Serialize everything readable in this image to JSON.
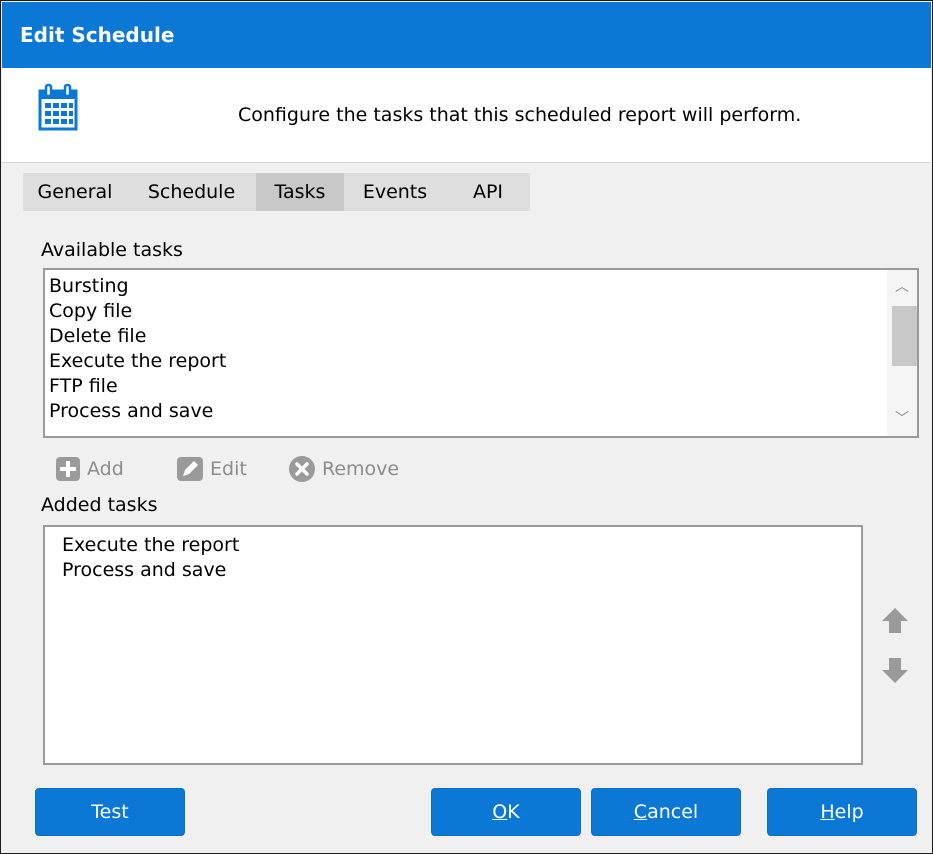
{
  "window": {
    "title": "Edit Schedule"
  },
  "header": {
    "icon": "calendar-icon",
    "message": "Configure the tasks that this scheduled report will perform."
  },
  "tabs": [
    {
      "label": "General",
      "active": false
    },
    {
      "label": "Schedule",
      "active": false
    },
    {
      "label": "Tasks",
      "active": true
    },
    {
      "label": "Events",
      "active": false
    },
    {
      "label": "API",
      "active": false
    }
  ],
  "available": {
    "label": "Available tasks",
    "items": [
      "Bursting",
      "Copy file",
      "Delete file",
      "Execute the report",
      "FTP file",
      "Process and save"
    ]
  },
  "toolbar": {
    "add": {
      "label": "Add",
      "icon": "plus-icon"
    },
    "edit": {
      "label": "Edit",
      "icon": "pencil-icon"
    },
    "remove": {
      "label": "Remove",
      "icon": "close-circle-icon"
    }
  },
  "added": {
    "label": "Added tasks",
    "items": [
      "Execute the report",
      "Process and save"
    ]
  },
  "move": {
    "up_icon": "arrow-up-icon",
    "down_icon": "arrow-down-icon"
  },
  "buttons": {
    "test": "Test",
    "ok_mnemonic": "O",
    "ok_rest": "K",
    "cancel_mnemonic": "C",
    "cancel_rest": "ancel",
    "help_mnemonic": "H",
    "help_rest": "elp"
  },
  "colors": {
    "accent": "#0a78d4",
    "disabled": "#8c8c8c",
    "arrow": "#9a9a9a"
  }
}
